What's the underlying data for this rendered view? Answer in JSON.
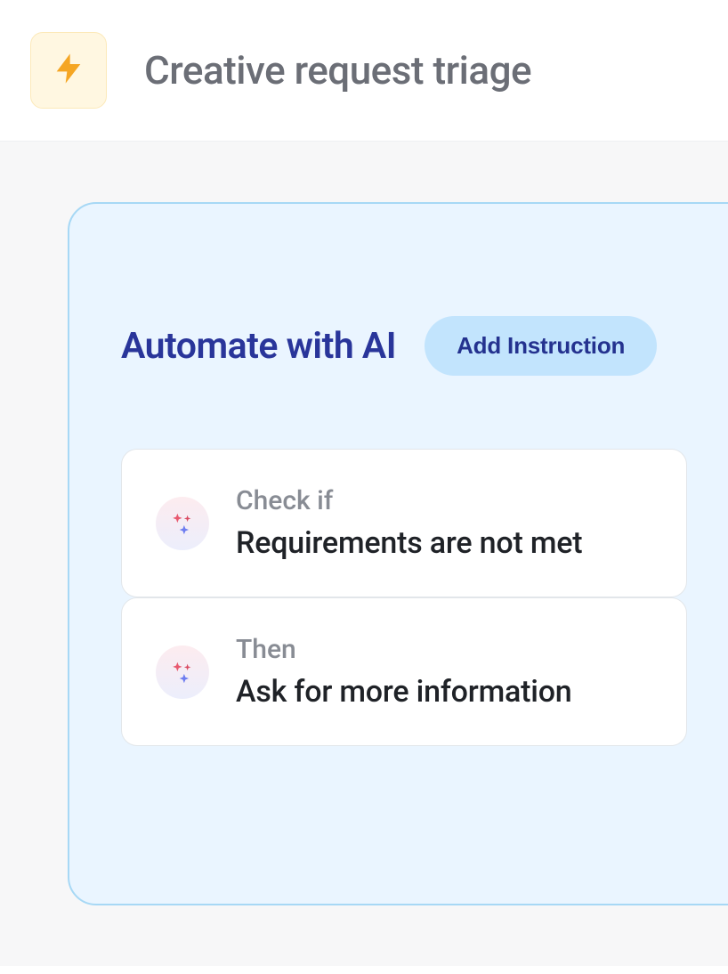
{
  "header": {
    "title": "Creative request triage",
    "icon": "bolt-icon"
  },
  "automation": {
    "title": "Automate with AI",
    "add_instruction_label": "Add Instruction",
    "steps": [
      {
        "label": "Check if",
        "value": "Requirements are not met"
      },
      {
        "label": "Then",
        "value": "Ask for more information"
      }
    ]
  }
}
